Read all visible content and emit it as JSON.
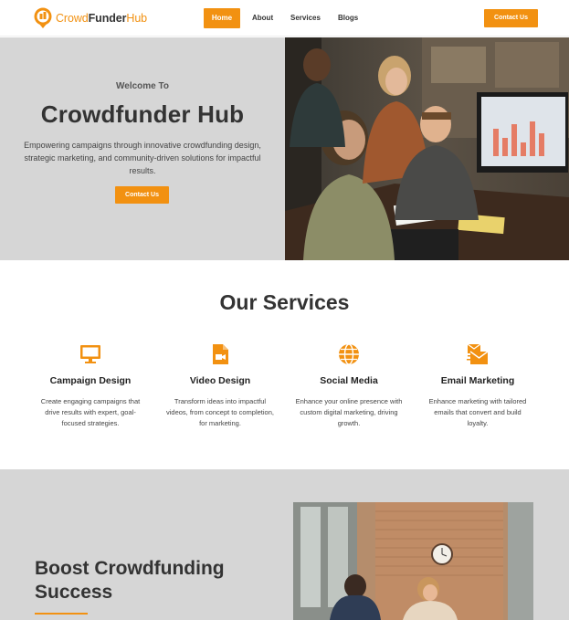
{
  "header": {
    "logo": {
      "part1": "Crowd",
      "part2": "Funder",
      "part3": "Hub"
    },
    "nav": {
      "home": "Home",
      "about": "About",
      "services": "Services",
      "blogs": "Blogs"
    },
    "contact_label": "Contact Us"
  },
  "hero": {
    "eyebrow": "Welcome To",
    "title": "Crowdfunder Hub",
    "description": "Empowering campaigns through innovative crowdfunding design, strategic marketing, and community-driven solutions for impactful results.",
    "button_label": "Contact Us"
  },
  "services": {
    "title": "Our Services",
    "items": [
      {
        "icon": "monitor-icon",
        "title": "Campaign Design",
        "description": "Create engaging campaigns that drive results with expert, goal-focused strategies."
      },
      {
        "icon": "video-file-icon",
        "title": "Video Design",
        "description": "Transform ideas into impactful videos, from concept to completion, for marketing."
      },
      {
        "icon": "globe-icon",
        "title": "Social Media",
        "description": "Enhance your online presence with custom digital marketing, driving growth."
      },
      {
        "icon": "email-marketing-icon",
        "title": "Email Marketing",
        "description": "Enhance marketing with tailored emails that convert and build loyalty."
      }
    ]
  },
  "boost": {
    "title": "Boost Crowdfunding Success"
  },
  "colors": {
    "accent": "#f29111",
    "panel": "#d6d6d6",
    "text": "#333333"
  }
}
